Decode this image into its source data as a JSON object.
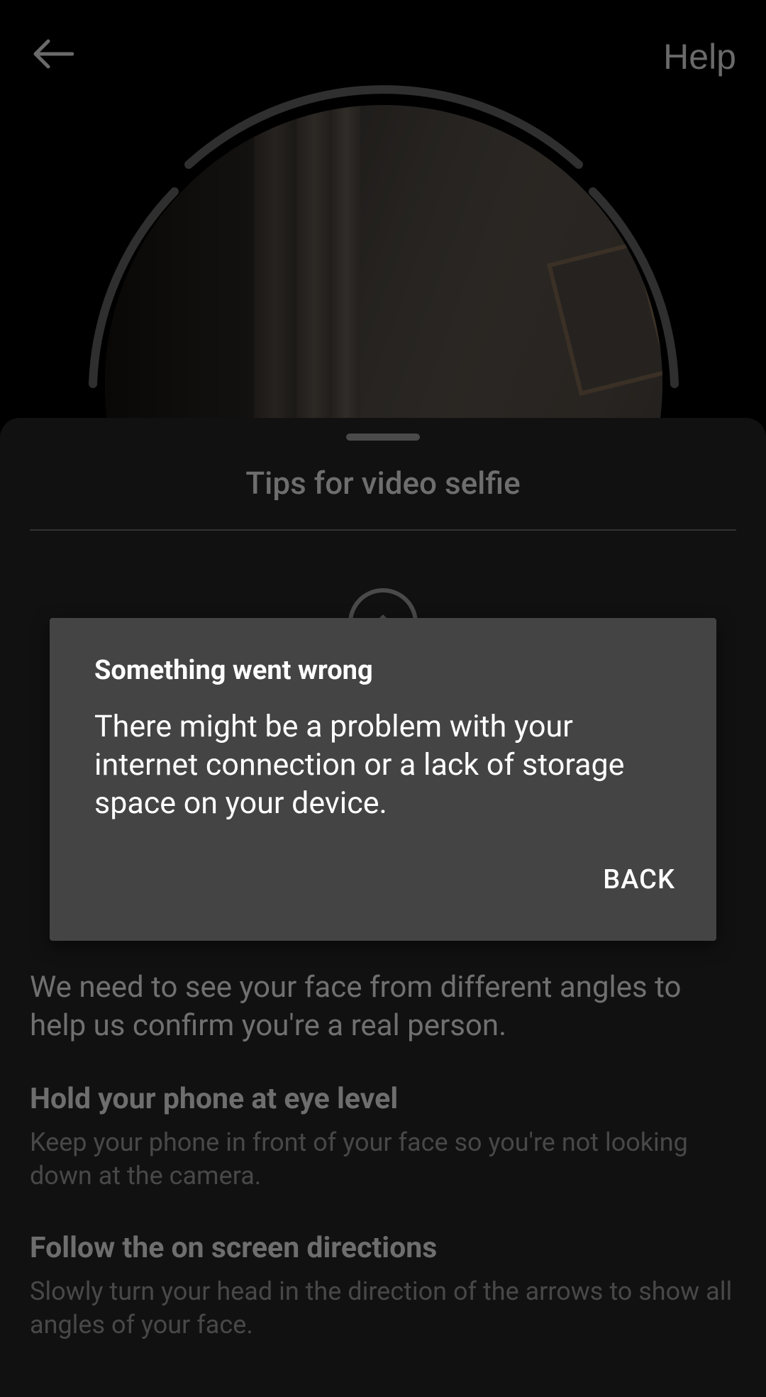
{
  "topbar": {
    "back_icon": "arrow-left-icon",
    "help_label": "Help"
  },
  "sheet": {
    "title": "Tips for video selfie",
    "tip_icon": "phone-eye-level-icon",
    "intro": "We need to see your face from different angles to help us confirm you're a real person.",
    "tips": [
      {
        "heading": "Hold your phone at eye level",
        "body": "Keep your phone in front of your face so you're not looking down at the camera."
      },
      {
        "heading": "Follow the on screen directions",
        "body": "Slowly turn your head in the direction of the arrows to show all angles of your face."
      }
    ]
  },
  "dialog": {
    "title": "Something went wrong",
    "message": "There might be a problem with your internet connection or a lack of storage space on your device.",
    "back_label": "BACK"
  },
  "colors": {
    "background": "#000000",
    "sheet": "#111111",
    "dialog": "#444444",
    "dialog_text": "#ffffff"
  }
}
